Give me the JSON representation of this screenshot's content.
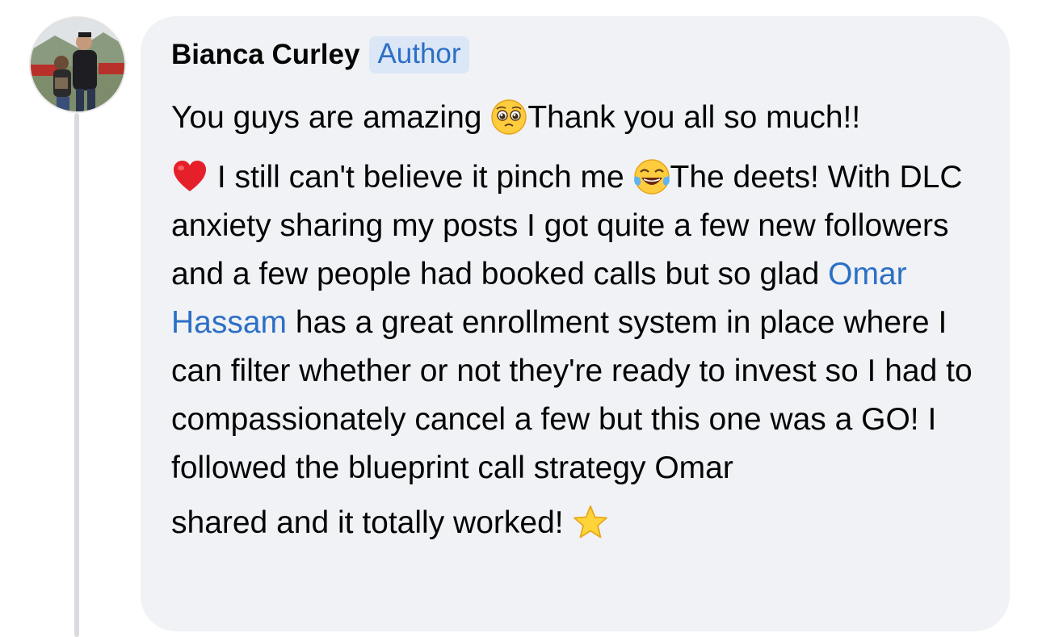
{
  "comment": {
    "author": {
      "name": "Bianca Curley",
      "badge": "Author",
      "avatar_icon": "profile-photo"
    },
    "paragraph1": {
      "text_before": "You guys are amazing",
      "emoji1": "pleading-face-emoji",
      "text_after": "Thank you all so much!!"
    },
    "paragraph2": {
      "emoji_heart": "red-heart-emoji",
      "text1": " I still can't believe it pinch me ",
      "emoji_laugh": "tears-of-joy-emoji",
      "text2": "The deets! With DLC anxiety sharing my posts I got quite a few new followers and a few people had booked calls but so glad ",
      "mention": "Omar Hassam",
      "text3": " has a great enrollment system in place where I can filter whether or not they're ready to invest so I had to compassionately cancel a few but this one was a GO! I followed the blueprint call strategy Omar",
      "text4": "shared and it totally worked! ",
      "emoji_star": "star-emoji"
    }
  },
  "colors": {
    "bubble_bg": "#f0f2f5",
    "link": "#2c6fc5",
    "badge_bg": "#dbe7f7",
    "text": "#050505"
  }
}
